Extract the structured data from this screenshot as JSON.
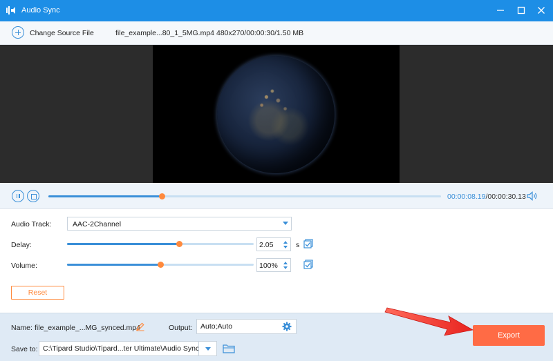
{
  "window": {
    "title": "Audio Sync",
    "controls": [
      "minimize-icon",
      "maximize-icon",
      "close-icon"
    ]
  },
  "source": {
    "change_label": "Change Source File",
    "file_name": "file_example...80_1_5MG.mp4",
    "file_meta": "480x270/00:00:30/1.50 MB"
  },
  "player": {
    "current_time": "00:00:08.19",
    "separator": "/",
    "total_time": "00:00:30.13",
    "progress_fraction": 0.29
  },
  "settings": {
    "audio_track": {
      "label": "Audio Track:",
      "value": "AAC-2Channel"
    },
    "delay": {
      "label": "Delay:",
      "value": "2.05",
      "unit": "s",
      "slider_fraction": 0.6
    },
    "volume": {
      "label": "Volume:",
      "value": "100%",
      "slider_fraction": 0.5
    },
    "reset_label": "Reset"
  },
  "footer": {
    "name_label": "Name:",
    "name_value": "file_example_...MG_synced.mp4",
    "output_label": "Output:",
    "output_value": "Auto;Auto",
    "save_label": "Save to:",
    "save_path": "C:\\Tipard Studio\\Tipard...ter Ultimate\\Audio Sync",
    "export_label": "Export"
  },
  "colors": {
    "titlebar": "#1d8ee6",
    "accent": "#3a8fd8",
    "slider_knob": "#ff8a3d",
    "export": "#ff6b45",
    "annotation_arrow": "#e8231f"
  }
}
